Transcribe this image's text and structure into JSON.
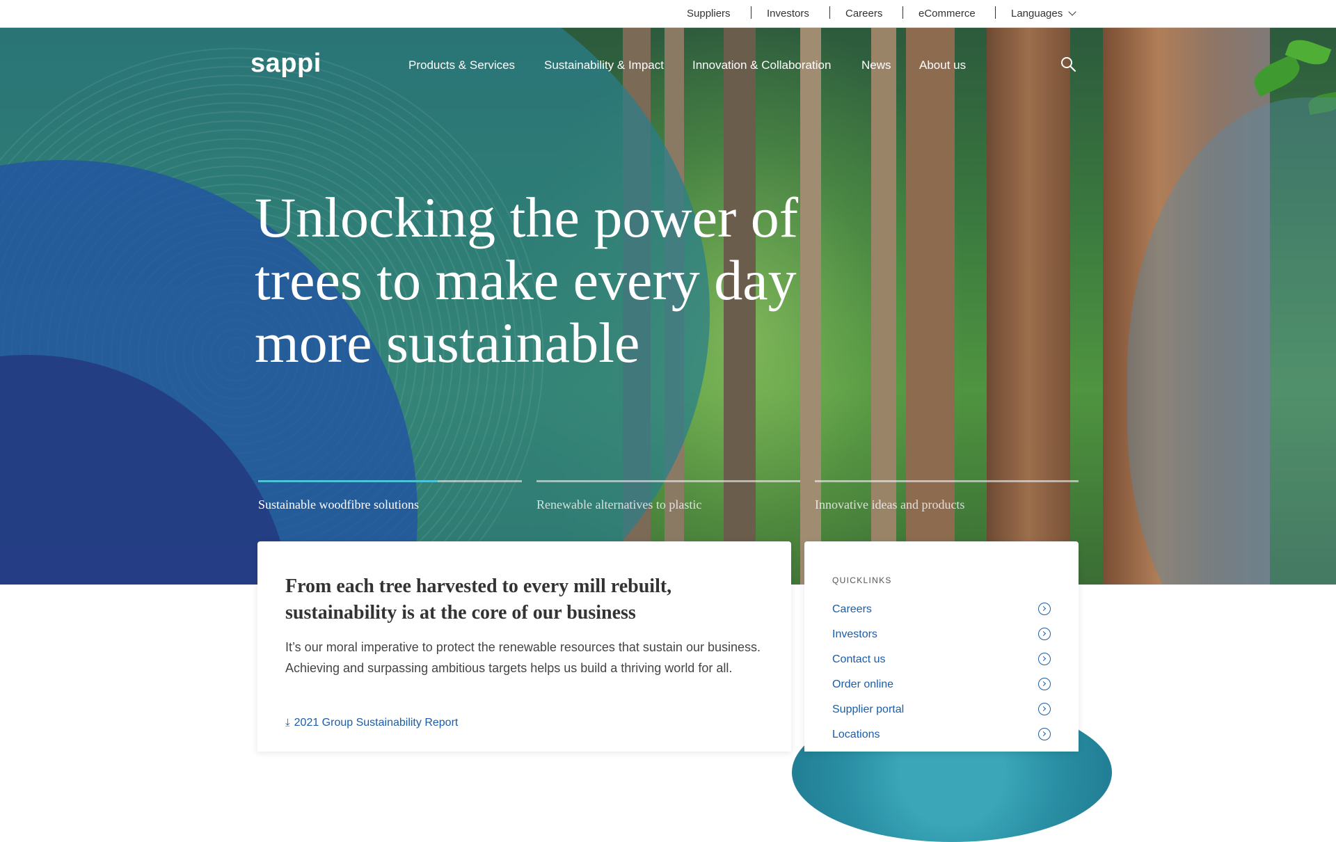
{
  "utility_nav": {
    "items": [
      {
        "label": "Suppliers"
      },
      {
        "label": "Investors"
      },
      {
        "label": "Careers"
      },
      {
        "label": "eCommerce"
      },
      {
        "label": "Languages"
      }
    ]
  },
  "header": {
    "logo_text": "sappi",
    "nav": [
      {
        "label": "Products & Services"
      },
      {
        "label": "Sustainability & Impact"
      },
      {
        "label": "Innovation & Collaboration"
      },
      {
        "label": "News"
      },
      {
        "label": "About us"
      }
    ],
    "search_icon": "search-icon"
  },
  "hero": {
    "headline_lines": [
      "Unlocking the power of",
      "trees to make every day",
      "more sustainable"
    ],
    "tabs": [
      {
        "label": "Sustainable woodfibre solutions",
        "active": true,
        "progress": 0.68
      },
      {
        "label": "Renewable alternatives to plastic",
        "active": false,
        "progress": 0
      },
      {
        "label": "Innovative ideas and products",
        "active": false,
        "progress": 0
      }
    ]
  },
  "main_card": {
    "heading": "From each tree harvested to every mill rebuilt, sustainability is at the core of our business",
    "body": "It’s our moral imperative to protect the renewable resources that sustain our business. Achieving and surpassing ambitious targets helps us build a thriving world for all.",
    "link_label": "2021 Group Sustainability Report",
    "link_icon": "download-icon"
  },
  "quicklinks": {
    "title": "QUICKLINKS",
    "items": [
      {
        "label": "Careers"
      },
      {
        "label": "Investors"
      },
      {
        "label": "Contact us"
      },
      {
        "label": "Order online"
      },
      {
        "label": "Supplier portal"
      },
      {
        "label": "Locations"
      }
    ],
    "item_icon": "arrow-circle-icon"
  },
  "colors": {
    "link_blue": "#1a5da8",
    "accent_teal": "#4ec3d8",
    "heading_dark": "#333333"
  }
}
